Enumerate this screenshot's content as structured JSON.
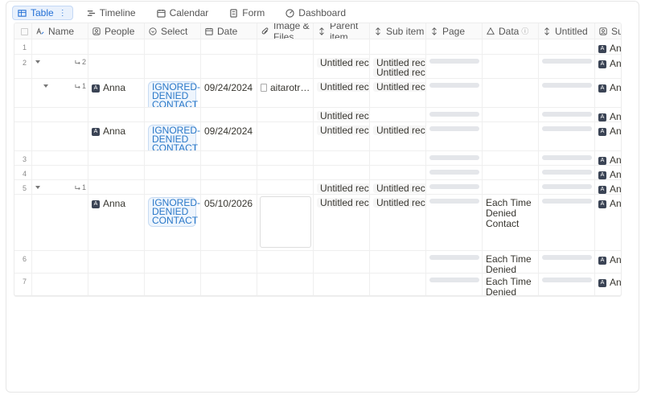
{
  "views": [
    {
      "label": "Table",
      "icon": "table-icon",
      "active": true
    },
    {
      "label": "Timeline",
      "icon": "timeline-icon"
    },
    {
      "label": "Calendar",
      "icon": "calendar-icon"
    },
    {
      "label": "Form",
      "icon": "form-icon"
    },
    {
      "label": "Dashboard",
      "icon": "dashboard-icon"
    }
  ],
  "columns": [
    {
      "label": "Name",
      "icon": "name-text-icon"
    },
    {
      "label": "People",
      "icon": "people-icon"
    },
    {
      "label": "Select",
      "icon": "select-icon"
    },
    {
      "label": "Date",
      "icon": "calendar-icon"
    },
    {
      "label": "Image & Files",
      "icon": "attachment-icon"
    },
    {
      "label": "Parent item",
      "icon": "link-icon"
    },
    {
      "label": "Sub item",
      "icon": "link-icon"
    },
    {
      "label": "Page",
      "icon": "link-icon"
    },
    {
      "label": "Data",
      "icon": "formula-icon",
      "info": "ⓘ"
    },
    {
      "label": "Untitled",
      "icon": "link-icon"
    },
    {
      "label": "Subm",
      "icon": "people-icon"
    }
  ],
  "rows": [
    {
      "num": "1",
      "submitter": "Anna"
    },
    {
      "num": "2",
      "subcount": "2",
      "caret": true,
      "parent": "Untitled record",
      "sub": [
        "Untitled record",
        "Untitled record"
      ],
      "submitter": "Anna"
    },
    {
      "child": true,
      "caret": true,
      "subcount": "1",
      "people": "Anna",
      "select": "IGNORED-DENIED CONTACT",
      "date": "09/24/2024",
      "file": "aitarotreadin...",
      "parent": "Untitled record",
      "sub": [
        "Untitled record"
      ],
      "submitter": "Anna"
    },
    {
      "child": true,
      "parent": "Untitled record",
      "submitter": "Anna"
    },
    {
      "child": true,
      "people": "Anna",
      "select": "IGNORED-DENIED CONTACT",
      "date": "09/24/2024",
      "parent": "Untitled record",
      "sub": [
        "Untitled record"
      ],
      "submitter": "Anna"
    },
    {
      "num": "3",
      "submitter": "Anna"
    },
    {
      "num": "4",
      "submitter": "Anna"
    },
    {
      "num": "5",
      "caret": true,
      "subcount": "1",
      "parent": "Untitled record",
      "sub": [
        "Untitled record"
      ],
      "submitter": "Anna"
    },
    {
      "child": true,
      "people": "Anna",
      "select": "IGNORED-DENIED CONTACT",
      "date": "05/10/2026",
      "image": true,
      "parent": "Untitled record",
      "sub": [
        "Untitled record"
      ],
      "data": "Each Time Denied Contact",
      "submitter": "Anna"
    },
    {
      "num": "6",
      "data": "Each Time Denied Contact",
      "submitter": "Anna"
    },
    {
      "num": "7",
      "data": "Each Time Denied Contact",
      "submitter": "Anna"
    }
  ],
  "avatar_letter": "A",
  "colors": {
    "accent": "#2470d6",
    "badge_text": "#2a78c8",
    "avatar": "#3b4455"
  }
}
